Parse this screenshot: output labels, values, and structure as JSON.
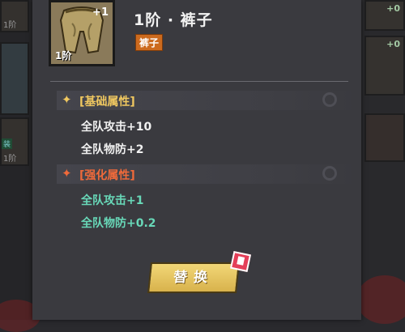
{
  "item": {
    "title": "1阶 · 裤子",
    "type_badge": "裤子",
    "tier_label": "1阶",
    "level_plus": "+1",
    "icon": "pants-icon"
  },
  "sections": {
    "base": {
      "title": "[基础属性]",
      "star_color": "#f0c860",
      "title_color": "#f0c860",
      "stats": [
        "全队攻击+10",
        "全队物防+2"
      ]
    },
    "enhanced": {
      "title": "[强化属性]",
      "star_color": "#f06a3a",
      "title_color": "#f06a3a",
      "stats": [
        "全队攻击+1",
        "全队物防+0.2"
      ]
    }
  },
  "actions": {
    "replace_label": "替换"
  },
  "background": {
    "left_slots": [
      {
        "tier": "1阶"
      },
      {
        "tier": "1阶",
        "tag": "装"
      }
    ],
    "right_slots": [
      {
        "plus": "+0"
      },
      {
        "plus": "+0"
      }
    ]
  }
}
